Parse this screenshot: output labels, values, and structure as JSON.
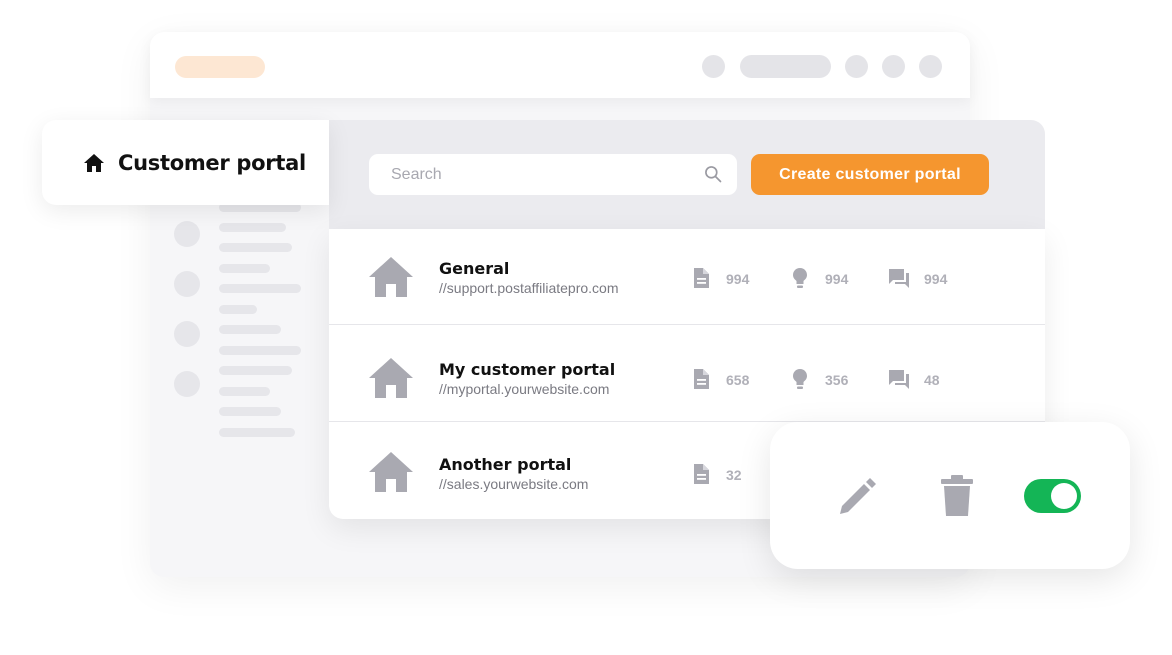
{
  "tab": {
    "title": "Customer portal",
    "icon": "home-icon"
  },
  "search": {
    "placeholder": "Search",
    "icon": "search-icon"
  },
  "create_button": {
    "label": "Create customer portal",
    "color": "#f5962f"
  },
  "portals": [
    {
      "name": "General",
      "url": "//support.postaffiliatepro.com",
      "articles": "994",
      "ideas": "994",
      "discussions": "994"
    },
    {
      "name": "My customer portal",
      "url": "//myportal.yourwebsite.com",
      "articles": "658",
      "ideas": "356",
      "discussions": "48"
    },
    {
      "name": "Another portal",
      "url": "//sales.yourwebsite.com",
      "articles": "32"
    }
  ],
  "actions": {
    "edit_icon": "pencil-icon",
    "delete_icon": "trash-icon",
    "toggle_state": "on",
    "toggle_color": "#14b556"
  }
}
